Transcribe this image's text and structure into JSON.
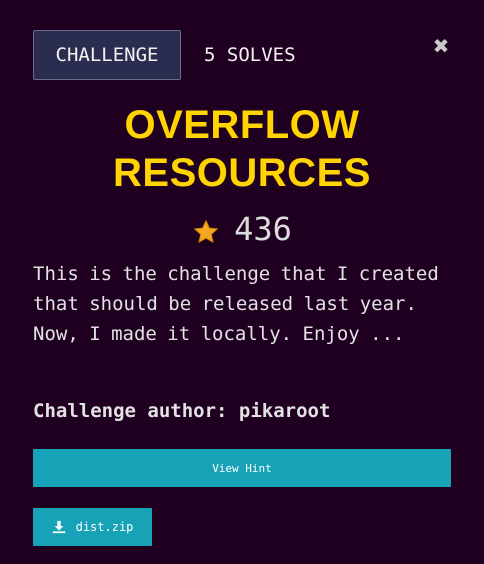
{
  "tabs": [
    {
      "label": "CHALLENGE",
      "active": true
    },
    {
      "label": "5 SOLVES",
      "active": false
    }
  ],
  "close_icon": {
    "glyph": "✖",
    "name": "close-icon"
  },
  "challenge": {
    "title_line1": "OVERFLOW",
    "title_line2": "RESOURCES",
    "points": "436",
    "description": "This is the challenge that I created that should be released last year. Now, I made it locally. Enjoy ...",
    "author": "Challenge author: pikaroot"
  },
  "hint_button": {
    "label": "View Hint"
  },
  "file": {
    "label": "dist.zip",
    "icon": "download-icon"
  },
  "colors": {
    "background": "#200020",
    "accent_title": "#ffd400",
    "button": "#17a2b8",
    "tab_active_bg": "#2a2d4f",
    "star": "#f5a623"
  }
}
